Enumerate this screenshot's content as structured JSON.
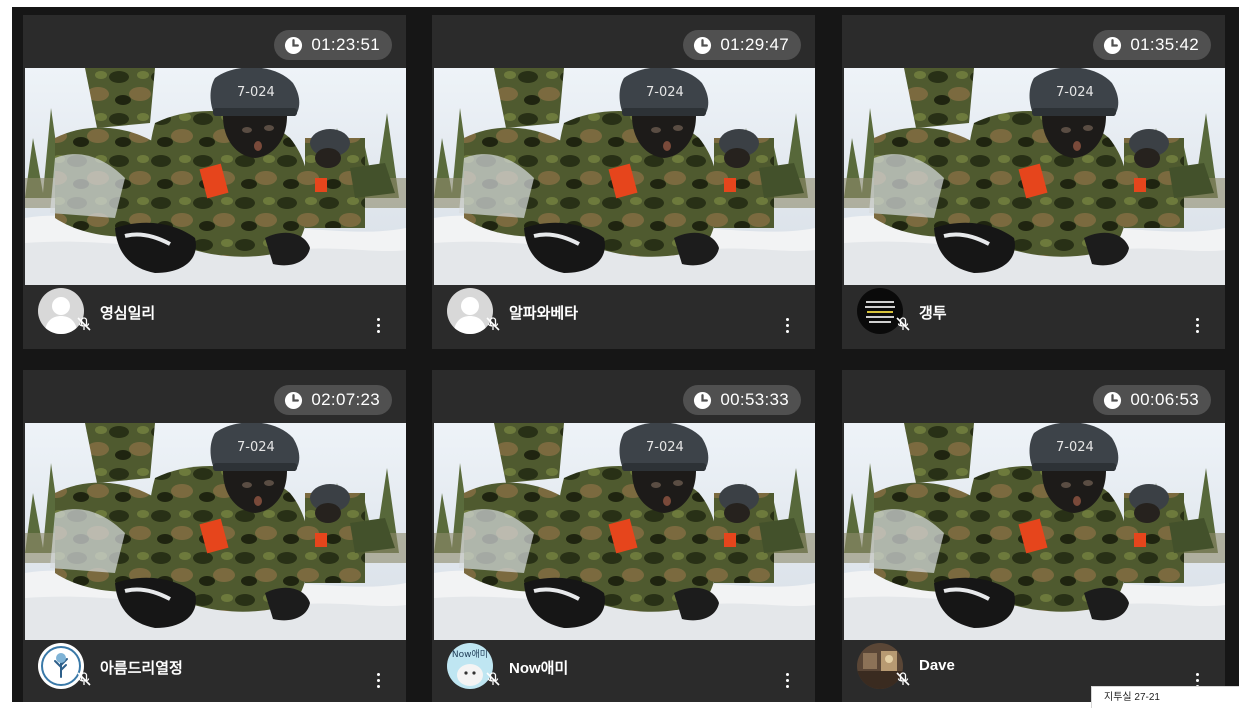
{
  "tiles": [
    {
      "timer": "01:23:51",
      "name": "영심일리",
      "avatar_icon": "default-person-avatar",
      "mic_icon": "mic-muted-icon",
      "avatar_text": ""
    },
    {
      "timer": "01:29:47",
      "name": "알파와베타",
      "avatar_icon": "default-person-avatar",
      "mic_icon": "mic-muted-icon",
      "avatar_text": ""
    },
    {
      "timer": "01:35:42",
      "name": "갱투",
      "avatar_icon": "text-image-avatar",
      "mic_icon": "mic-muted-icon",
      "avatar_text": ""
    },
    {
      "timer": "02:07:23",
      "name": "아름드리열정",
      "avatar_icon": "tree-logo-avatar",
      "mic_icon": "mic-muted-icon",
      "avatar_text": ""
    },
    {
      "timer": "00:53:33",
      "name": "Now애미",
      "avatar_icon": "cartoon-avatar",
      "mic_icon": "mic-muted-icon",
      "avatar_text": "Now애미"
    },
    {
      "timer": "00:06:53",
      "name": "Dave",
      "avatar_icon": "photo-avatar",
      "mic_icon": "mic-muted-icon",
      "avatar_text": ""
    }
  ],
  "footer_note": "지투실 27-21",
  "colors": {
    "stage_bg": "#161616",
    "card_bg": "#2b2b2b",
    "timer_bg": "#505050",
    "text": "#ffffff"
  }
}
